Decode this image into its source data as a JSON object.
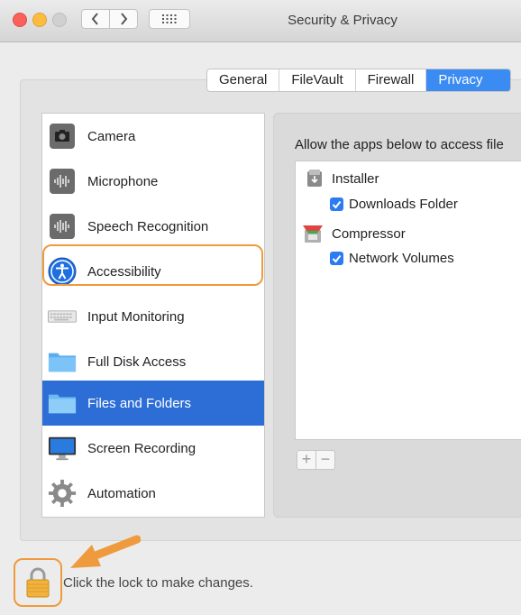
{
  "window": {
    "title": "Security & Privacy"
  },
  "tabs": [
    {
      "label": "General",
      "active": false
    },
    {
      "label": "FileVault",
      "active": false
    },
    {
      "label": "Firewall",
      "active": false
    },
    {
      "label": "Privacy",
      "active": true
    }
  ],
  "sidebar": {
    "items": [
      {
        "label": "Camera",
        "icon": "camera-icon"
      },
      {
        "label": "Microphone",
        "icon": "microphone-icon"
      },
      {
        "label": "Speech Recognition",
        "icon": "waveform-icon"
      },
      {
        "label": "Accessibility",
        "icon": "accessibility-icon"
      },
      {
        "label": "Input Monitoring",
        "icon": "keyboard-icon"
      },
      {
        "label": "Full Disk Access",
        "icon": "folder-icon"
      },
      {
        "label": "Files and Folders",
        "icon": "folder-icon",
        "selected": true
      },
      {
        "label": "Screen Recording",
        "icon": "display-icon"
      },
      {
        "label": "Automation",
        "icon": "gear-icon"
      }
    ]
  },
  "main": {
    "allow_text": "Allow the apps below to access file",
    "apps": [
      {
        "name": "Installer",
        "icon": "installer-icon",
        "permissions": [
          {
            "label": "Downloads Folder",
            "checked": true
          }
        ]
      },
      {
        "name": "Compressor",
        "icon": "compressor-icon",
        "permissions": [
          {
            "label": "Network Volumes",
            "checked": true
          }
        ]
      }
    ],
    "add_label": "+",
    "remove_label": "−"
  },
  "footer": {
    "lock_text": "Click the lock to make changes."
  },
  "colors": {
    "accent": "#3b8cf2",
    "selection": "#2d6ed6",
    "highlight": "#ef9a3c"
  }
}
